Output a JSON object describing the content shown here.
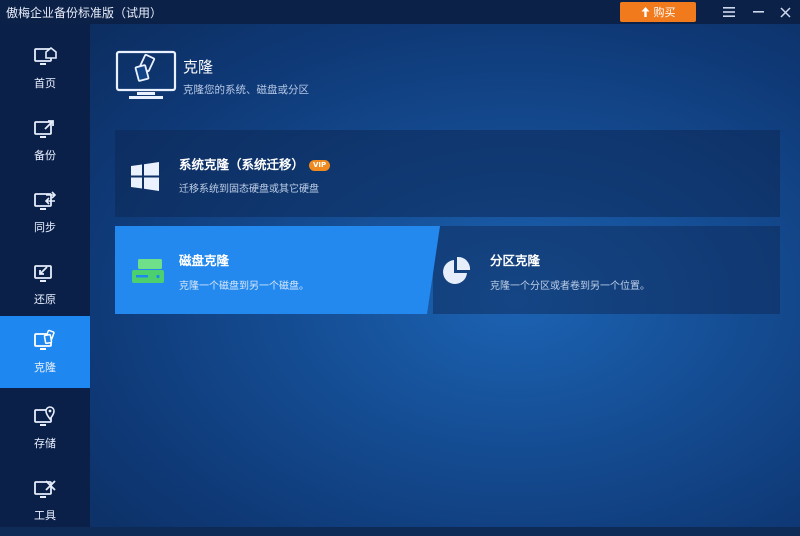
{
  "window": {
    "title": "傲梅企业备份标准版（试用）",
    "buy_label": "购买"
  },
  "sidebar": {
    "items": [
      {
        "label": "首页",
        "icon": "home-icon"
      },
      {
        "label": "备份",
        "icon": "backup-icon"
      },
      {
        "label": "同步",
        "icon": "sync-icon"
      },
      {
        "label": "还原",
        "icon": "restore-icon"
      },
      {
        "label": "克隆",
        "icon": "clone-icon",
        "active": true
      },
      {
        "label": "存储",
        "icon": "storage-icon"
      },
      {
        "label": "工具",
        "icon": "tools-icon"
      }
    ]
  },
  "header": {
    "title": "克隆",
    "subtitle": "克隆您的系统、磁盘或分区"
  },
  "cards": {
    "system_clone": {
      "title": "系统克隆（系统迁移）",
      "badge": "VIP",
      "desc": "迁移系统到固态硬盘或其它硬盘"
    },
    "disk_clone": {
      "title": "磁盘克隆",
      "desc": "克隆一个磁盘到另一个磁盘。",
      "selected": true
    },
    "partition_clone": {
      "title": "分区克隆",
      "desc": "克隆一个分区或者卷到另一个位置。"
    }
  },
  "colors": {
    "accent": "#1f88f0",
    "buy_button": "#f07a1c",
    "sidebar_bg": "#0b2048"
  }
}
